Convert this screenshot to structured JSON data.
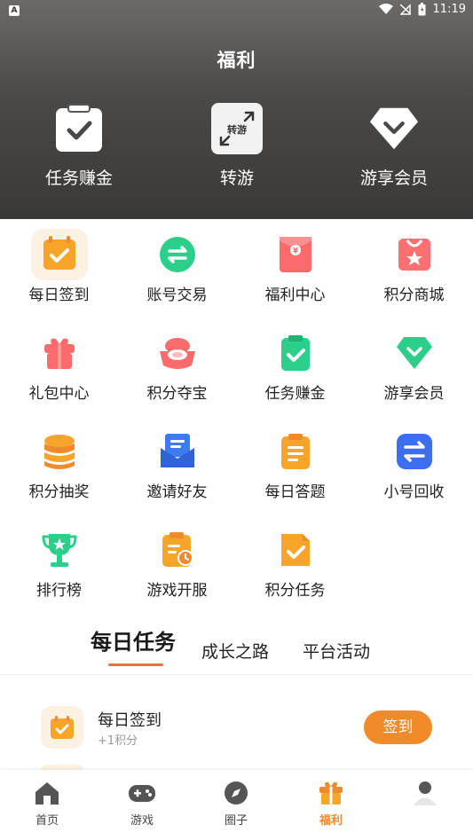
{
  "status": {
    "time": "11:19",
    "app_badge": "A"
  },
  "header": {
    "title": "福利",
    "items": [
      {
        "label": "任务赚金",
        "icon": "clipboard-check-icon"
      },
      {
        "label": "转游",
        "icon": "transfer-game-icon",
        "badge": "转游"
      },
      {
        "label": "游享会员",
        "icon": "diamond-icon"
      }
    ]
  },
  "grid": [
    {
      "label": "每日签到",
      "icon": "calendar-check-icon"
    },
    {
      "label": "账号交易",
      "icon": "exchange-icon"
    },
    {
      "label": "福利中心",
      "icon": "red-envelope-icon"
    },
    {
      "label": "积分商城",
      "icon": "shop-bag-icon"
    },
    {
      "label": "礼包中心",
      "icon": "gift-box-icon"
    },
    {
      "label": "积分夺宝",
      "icon": "treasure-icon"
    },
    {
      "label": "任务赚金",
      "icon": "task-clipboard-icon"
    },
    {
      "label": "游享会员",
      "icon": "green-diamond-icon"
    },
    {
      "label": "积分抽奖",
      "icon": "coin-stack-icon"
    },
    {
      "label": "邀请好友",
      "icon": "invite-mail-icon"
    },
    {
      "label": "每日答题",
      "icon": "quiz-clipboard-icon"
    },
    {
      "label": "小号回收",
      "icon": "recycle-arrows-icon"
    },
    {
      "label": "排行榜",
      "icon": "trophy-icon"
    },
    {
      "label": "游戏开服",
      "icon": "server-clock-icon"
    },
    {
      "label": "积分任务",
      "icon": "points-document-icon"
    }
  ],
  "tabs": [
    {
      "label": "每日任务",
      "active": true
    },
    {
      "label": "成长之路",
      "active": false
    },
    {
      "label": "平台活动",
      "active": false
    }
  ],
  "task": {
    "title": "每日签到",
    "sub": "+1积分",
    "button": "签到"
  },
  "bottom_nav": [
    {
      "label": "首页",
      "icon": "home-icon",
      "active": false
    },
    {
      "label": "游戏",
      "icon": "gamepad-icon",
      "active": false
    },
    {
      "label": "圈子",
      "icon": "compass-icon",
      "active": false
    },
    {
      "label": "福利",
      "icon": "gift-icon",
      "active": true
    },
    {
      "label": "",
      "icon": "profile-icon",
      "active": false
    }
  ],
  "colors": {
    "accent": "#f08a2a",
    "underline": "#e8723b"
  }
}
